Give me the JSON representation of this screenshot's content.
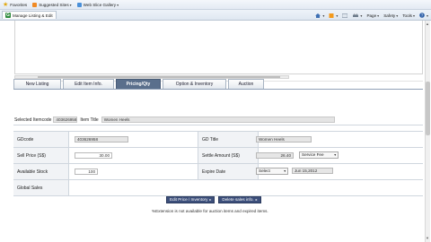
{
  "favorites_bar": {
    "favorites_label": "Favorites",
    "suggested_sites_label": "Suggested Sites",
    "web_slice_gallery_label": "Web Slice Gallery"
  },
  "command_bar": {
    "tab_title": "Manage Listing & Edit",
    "tab_icon_letter": "G",
    "page_menu": "Page",
    "safety_menu": "Safety",
    "tools_menu": "Tools"
  },
  "tabs": [
    {
      "label": "New Listing",
      "active": false
    },
    {
      "label": "Edit Item Info.",
      "active": false
    },
    {
      "label": "Pricing/Qty",
      "active": true
    },
    {
      "label": "Option & Inventory",
      "active": false
    },
    {
      "label": "Auction",
      "active": false
    }
  ],
  "selected": {
    "itemcode_label": "Selected Itemcode",
    "itemcode_value": "403626958",
    "item_title_label": "Item Title",
    "item_title_value": "Women Heels"
  },
  "grid": {
    "gdcode_label": "GDcode",
    "gdcode_value": "403626958",
    "gd_title_label": "GD Title",
    "gd_title_value": "Women Heels",
    "sell_price_label": "Sell Price (S$)",
    "sell_price_value": "30.00",
    "settle_amount_label": "Settle Amount (S$)",
    "settle_amount_value": "26.40",
    "service_fee_option": "Service Fee",
    "available_stock_label": "Available Stock",
    "available_stock_value": "100",
    "expire_date_label": "Expire Date",
    "expire_select_option": "Select",
    "expire_date_value": "Jun 15,2012",
    "global_sales_label": "Global Sales"
  },
  "actions": {
    "edit_price_label": "Edit Price / Inventory",
    "delete_sales_label": "Delete sales info."
  },
  "note": "%Extension is not available for auction items and expired items."
}
